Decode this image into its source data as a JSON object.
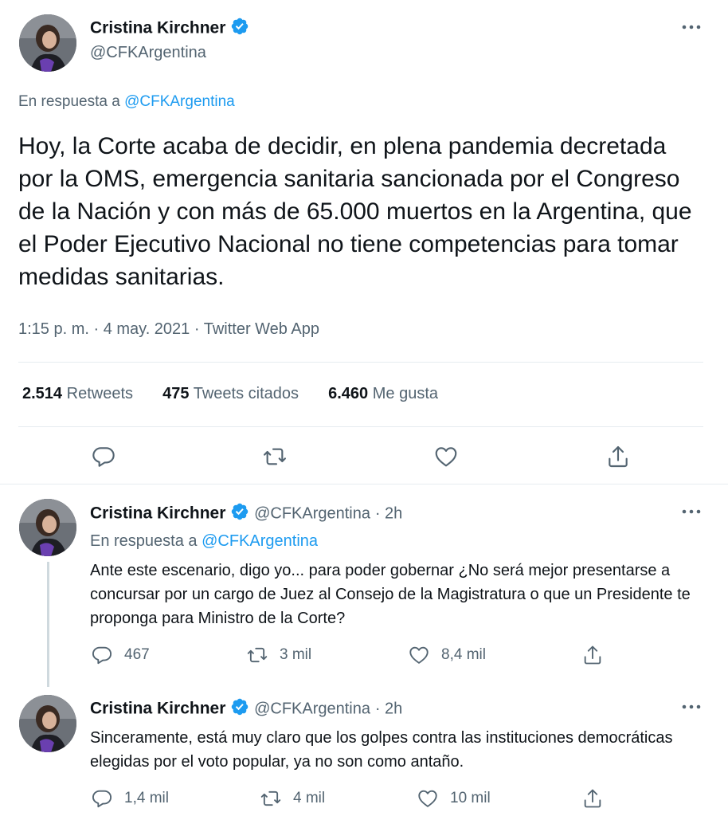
{
  "main_tweet": {
    "author_name": "Cristina Kirchner",
    "author_handle": "@CFKArgentina",
    "reply_prefix": "En respuesta a",
    "reply_to": "@CFKArgentina",
    "text": "Hoy, la Corte acaba de decidir, en plena pandemia decretada por la OMS, emergencia sanitaria sancionada por el Congreso de la Nación y con más de 65.000 muertos en la Argentina, que el Poder Ejecutivo Nacional no tiene competencias para tomar medidas sanitarias.",
    "timestamp": "1:15 p. m. · 4 may. 2021 · Twitter Web App",
    "stats": {
      "retweets_count": "2.514",
      "retweets_label": "Retweets",
      "quotes_count": "475",
      "quotes_label": "Tweets citados",
      "likes_count": "6.460",
      "likes_label": "Me gusta"
    }
  },
  "replies": [
    {
      "author_name": "Cristina Kirchner",
      "author_handle": "@CFKArgentina",
      "time": "· 2h",
      "reply_prefix": "En respuesta a",
      "reply_to": "@CFKArgentina",
      "text": "Ante este escenario, digo yo... para poder gobernar ¿No será mejor presentarse a concursar por un cargo de Juez al Consejo de la Magistratura o que un Presidente te proponga para Ministro de la Corte?",
      "replies_count": "467",
      "retweets_count": "3 mil",
      "likes_count": "8,4 mil"
    },
    {
      "author_name": "Cristina Kirchner",
      "author_handle": "@CFKArgentina",
      "time": "· 2h",
      "text": "Sinceramente, está muy claro que los golpes contra las instituciones democráticas elegidas por el voto popular, ya no son como antaño.",
      "replies_count": "1,4 mil",
      "retweets_count": "4 mil",
      "likes_count": "10 mil"
    }
  ],
  "colors": {
    "accent": "#1d9bf0",
    "text_primary": "#0f1419",
    "text_secondary": "#536471",
    "divider": "#e6ecf0"
  }
}
